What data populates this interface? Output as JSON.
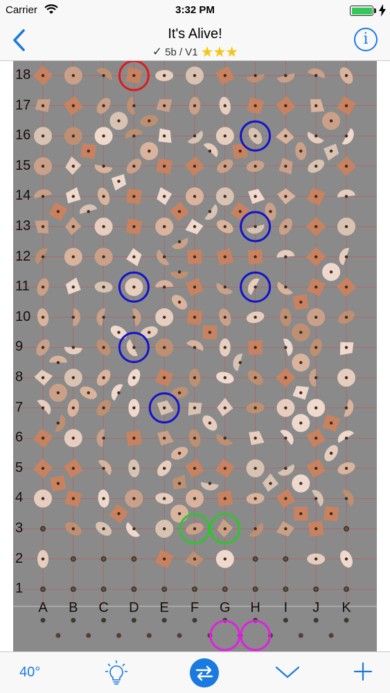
{
  "status_bar": {
    "carrier": "Carrier",
    "time": "3:32 PM",
    "battery_level": 1.0
  },
  "nav": {
    "title": "It's Alive!",
    "check_mark": "✓",
    "grade": "5b / V1",
    "stars": "★★★",
    "star_count": 3,
    "info_symbol": "i"
  },
  "board": {
    "rows": [
      "18",
      "17",
      "16",
      "15",
      "14",
      "13",
      "12",
      "11",
      "10",
      "9",
      "8",
      "7",
      "6",
      "5",
      "4",
      "3",
      "2",
      "1"
    ],
    "columns": [
      "A",
      "B",
      "C",
      "D",
      "E",
      "F",
      "G",
      "H",
      "I",
      "J",
      "K"
    ],
    "marked_holds": [
      {
        "col": "D",
        "row": 18,
        "type": "finish",
        "color": "#e01b1b"
      },
      {
        "col": "H",
        "row": 16,
        "type": "hand",
        "color": "#1414c8"
      },
      {
        "col": "H",
        "row": 13,
        "type": "hand",
        "color": "#1414c8"
      },
      {
        "col": "D",
        "row": 11,
        "type": "hand",
        "color": "#1414c8"
      },
      {
        "col": "H",
        "row": 11,
        "type": "hand",
        "color": "#1414c8"
      },
      {
        "col": "D",
        "row": 9,
        "type": "hand",
        "color": "#1414c8"
      },
      {
        "col": "E",
        "row": 7,
        "type": "hand",
        "color": "#1414c8"
      },
      {
        "col": "F",
        "row": 3,
        "type": "start",
        "color": "#2fc42f"
      },
      {
        "col": "G",
        "row": 3,
        "type": "start",
        "color": "#2fc42f"
      }
    ],
    "foot_holds": [
      {
        "slot": 6,
        "color": "#e020e0"
      },
      {
        "slot": 7,
        "color": "#e020e0"
      }
    ]
  },
  "tab_bar": {
    "angle": "40°",
    "bulb_icon": "lightbulb-icon",
    "swap_icon": "swap-arrows-icon",
    "chevron_icon": "chevron-down-icon",
    "plus_icon": "plus-icon"
  },
  "colors": {
    "accent": "#1a7ae0",
    "board": "#8a8a8a",
    "grid": "#c85050",
    "star": "#f5c518"
  }
}
